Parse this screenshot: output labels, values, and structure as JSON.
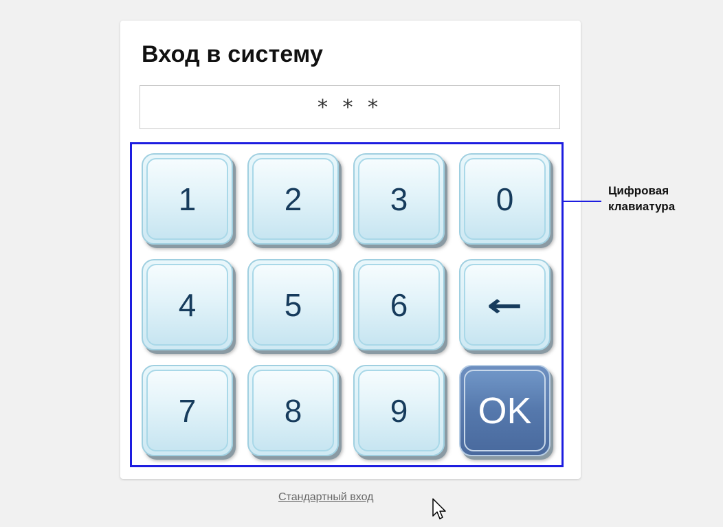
{
  "login": {
    "title": "Вход в систему",
    "pin_value": "* * *"
  },
  "keypad": {
    "keys": [
      {
        "label": "1",
        "name": "key-1"
      },
      {
        "label": "2",
        "name": "key-2"
      },
      {
        "label": "3",
        "name": "key-3"
      },
      {
        "label": "0",
        "name": "key-0"
      },
      {
        "label": "4",
        "name": "key-4"
      },
      {
        "label": "5",
        "name": "key-5"
      },
      {
        "label": "6",
        "name": "key-6"
      },
      {
        "label": "←",
        "name": "backspace-button",
        "icon": "left-arrow-icon"
      },
      {
        "label": "7",
        "name": "key-7"
      },
      {
        "label": "8",
        "name": "key-8"
      },
      {
        "label": "9",
        "name": "key-9"
      },
      {
        "label": "OK",
        "name": "ok-button"
      }
    ]
  },
  "annotation": {
    "line1": "Цифровая",
    "line2": "клавиатура"
  },
  "footer": {
    "alt_login_link": "Стандартный вход"
  },
  "colors": {
    "keypad_border": "#1d1de0",
    "key_text": "#163b5c",
    "ok_button": "#5578ac",
    "background": "#f1f1f1"
  },
  "icons": {
    "backspace": "left-arrow-icon",
    "cursor": "mouse-pointer-icon"
  }
}
